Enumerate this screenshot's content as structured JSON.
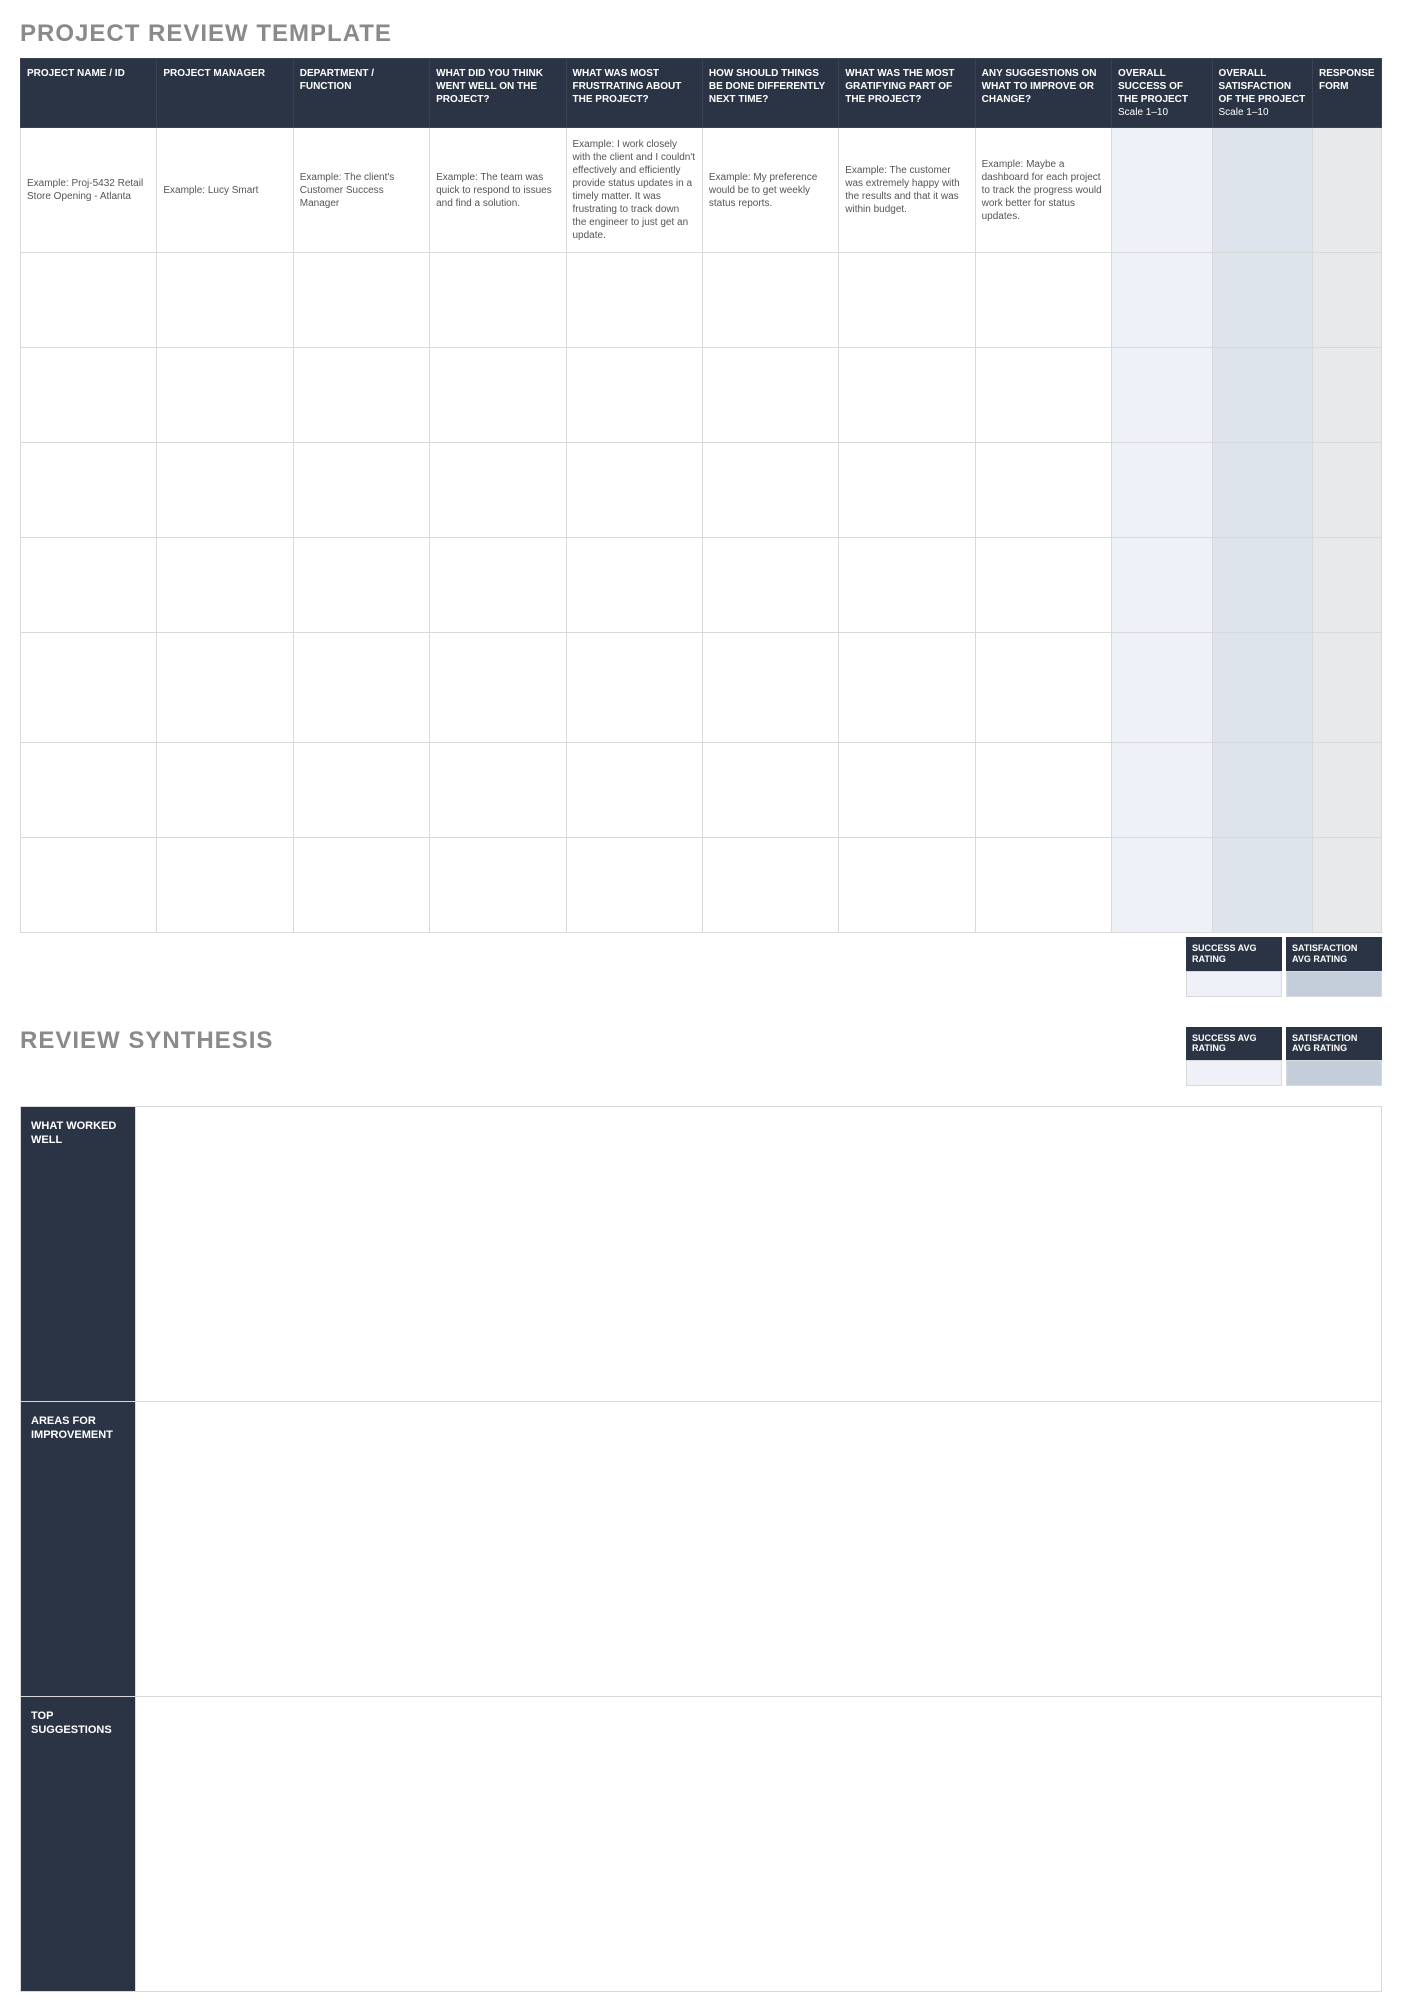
{
  "title_main": "PROJECT REVIEW TEMPLATE",
  "title_synth": "REVIEW SYNTHESIS",
  "headers": {
    "c1": "PROJECT NAME / ID",
    "c2": "PROJECT MANAGER",
    "c3": "DEPARTMENT / FUNCTION",
    "c4": "WHAT DID YOU THINK WENT WELL ON THE PROJECT?",
    "c5": "WHAT WAS MOST FRUSTRATING ABOUT THE PROJECT?",
    "c6": "HOW SHOULD THINGS BE DONE DIFFERENTLY NEXT TIME?",
    "c7": "WHAT WAS THE MOST GRATIFYING PART OF THE PROJECT?",
    "c8": "ANY SUGGESTIONS ON WHAT TO IMPROVE OR CHANGE?",
    "c9": "OVERALL SUCCESS OF THE PROJECT",
    "c9s": "Scale 1–10",
    "c10": "OVERALL SATISFACTION OF THE PROJECT",
    "c10s": "Scale 1–10",
    "c11": "RESPONSE FORM"
  },
  "example": {
    "c1": "Example: Proj-5432 Retail Store Opening - Atlanta",
    "c2": "Example: Lucy Smart",
    "c3": "Example: The client's Customer Success Manager",
    "c4": "Example: The team was quick to respond to issues and find a solution.",
    "c5": "Example: I work closely with the client and I couldn't effectively and efficiently provide status updates in a timely matter. It was frustrating to track down the engineer to just get an update.",
    "c6": "Example: My preference would be to get weekly status reports.",
    "c7": "Example: The customer was extremely happy with the results and that it was within budget.",
    "c8": "Example: Maybe a dashboard for each project to track the progress would work better for status updates."
  },
  "avg": {
    "success": "SUCCESS AVG RATING",
    "satisfaction": "SATISFACTION AVG RATING"
  },
  "synth": {
    "r1": "WHAT WORKED WELL",
    "r2": "AREAS FOR IMPROVEMENT",
    "r3": "TOP SUGGESTIONS"
  }
}
